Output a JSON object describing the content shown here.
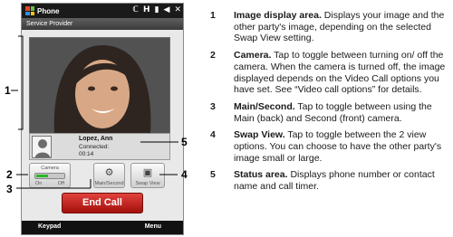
{
  "phone": {
    "title": "Phone",
    "status_icons": [
      "ℂ",
      "H",
      "▮",
      "◀",
      "✕"
    ],
    "provider": "Service Provider",
    "contact": {
      "name": "Lopez, Ann",
      "status": "Connected:",
      "timer": "00:14"
    },
    "camera": {
      "label": "Camera",
      "on": "On",
      "off": "Off"
    },
    "main_second_label": "Main/Second",
    "swap_view_label": "Swap View",
    "end_call_label": "End Call",
    "soft_left": "Keypad",
    "soft_right": "Menu",
    "colors": {
      "end_call": "#c8201a",
      "camera_on": "#2bb52b",
      "titlebar": "#1a1a1a"
    }
  },
  "callouts": [
    "1",
    "2",
    "3",
    "4",
    "5"
  ],
  "legend": [
    {
      "num": "1",
      "title": "Image display area.",
      "text": " Displays your image and the other party's image, depending on the selected Swap View setting."
    },
    {
      "num": "2",
      "title": "Camera.",
      "text": " Tap to toggle between turning on/ off the camera. When the camera is turned off, the image displayed depends on the Video Call options you have set. See “Video call options” for details."
    },
    {
      "num": "3",
      "title": "Main/Second.",
      "text": " Tap to toggle between using the Main (back) and Second (front) camera."
    },
    {
      "num": "4",
      "title": "Swap View.",
      "text": " Tap to toggle between the 2 view options. You can choose to have the other party's image small or large."
    },
    {
      "num": "5",
      "title": "Status area.",
      "text": " Displays phone number or contact name and call timer."
    }
  ]
}
